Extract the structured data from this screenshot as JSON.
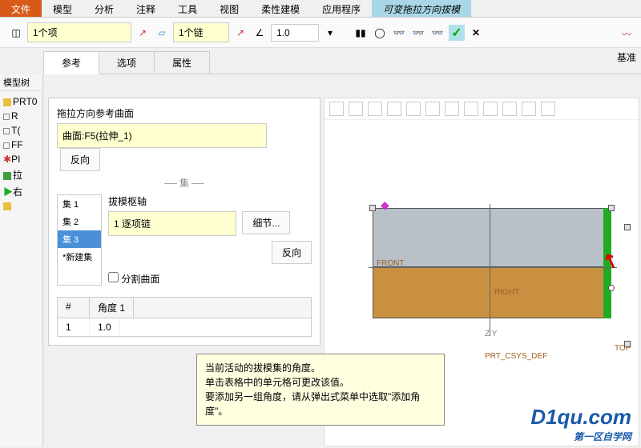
{
  "menu": {
    "items": [
      "文件",
      "模型",
      "分析",
      "注释",
      "工具",
      "视图",
      "柔性建模",
      "应用程序",
      "可变拖拉方向拔模"
    ],
    "active_idx": 0,
    "highlight_idx": 8
  },
  "toolbar": {
    "item_label": "1个项",
    "chain_label": "1个链",
    "num": "1.0"
  },
  "sidebar": {
    "title": "模型树",
    "entries": [
      "PRT0",
      "R",
      "T(",
      "FF",
      "PI",
      "拉",
      "右"
    ]
  },
  "tabs": {
    "items": [
      "参考",
      "选项",
      "属性"
    ],
    "active_idx": 0
  },
  "panel": {
    "ref_label": "拖拉方向参考曲面",
    "ref_value": "曲面:F5(拉伸_1)",
    "reverse": "反向",
    "set_header": "集",
    "sets": [
      "集 1",
      "集 2",
      "集 3",
      "*新建集"
    ],
    "sets_sel_idx": 2,
    "axis_label": "拔模枢轴",
    "axis_value": "1 逐项链",
    "detail": "细节...",
    "split": "分割曲面",
    "col_idx": "#",
    "col_angle": "角度 1",
    "row_idx": "1",
    "row_angle": "1.0"
  },
  "tooltip": {
    "l1": "当前活动的拔模集的角度。",
    "l2": "单击表格中的单元格可更改该值。",
    "l3": "要添加另一组角度，请从弹出式菜单中选取\"添加角度\"。"
  },
  "viewport": {
    "front": "FRONT",
    "right": "RIGHT",
    "top": "TOP",
    "csys": "PRT_CSYS_DEF",
    "zy": "Z Y"
  },
  "right": {
    "basis": "基准"
  },
  "watermark": {
    "main": "D1qu.com",
    "sub": "第一区自学网"
  }
}
